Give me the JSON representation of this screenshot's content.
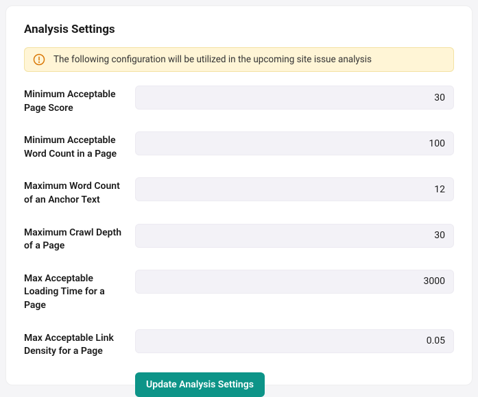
{
  "title": "Analysis Settings",
  "banner": {
    "text": "The following configuration will be utilized in the upcoming site issue analysis"
  },
  "fields": {
    "min_page_score": {
      "label": "Minimum Acceptable Page Score",
      "value": "30"
    },
    "min_word_count": {
      "label": "Minimum Acceptable Word Count in a Page",
      "value": "100"
    },
    "max_anchor_words": {
      "label": "Maximum Word Count of an Anchor Text",
      "value": "12"
    },
    "max_crawl_depth": {
      "label": "Maximum Crawl Depth of a Page",
      "value": "30"
    },
    "max_load_time": {
      "label": "Max Acceptable Loading Time for a Page",
      "value": "3000"
    },
    "max_link_density": {
      "label": "Max Acceptable Link Density for a Page",
      "value": "0.05"
    }
  },
  "actions": {
    "update_label": "Update Analysis Settings"
  }
}
